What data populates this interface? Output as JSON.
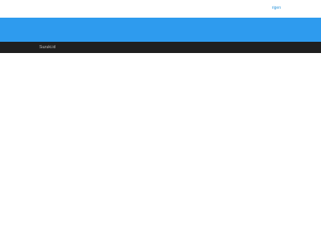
{
  "header": {
    "top_link": "rigen"
  },
  "nav": {
    "item_1": "Suzuki.id"
  },
  "colors": {
    "banner": "#2e9bee",
    "navbar": "#1f1f1f",
    "link": "#3399dd"
  }
}
